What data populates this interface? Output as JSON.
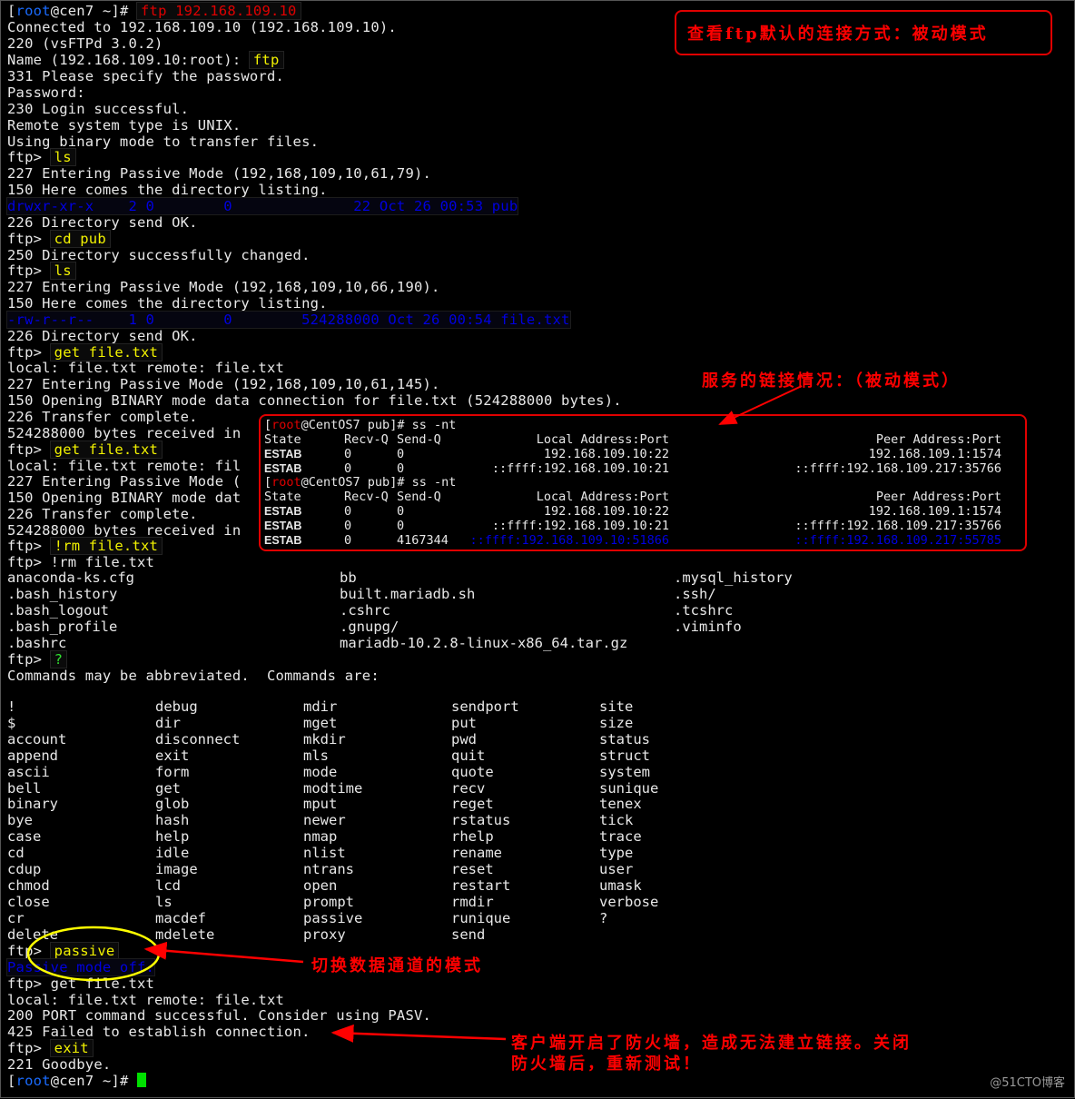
{
  "prompt": {
    "open": "[",
    "user": "root",
    "host_rest": "@cen7 ~]# "
  },
  "lines": {
    "l0_cmd": "ftp 192.168.109.10",
    "l1": "Connected to 192.168.109.10 (192.168.109.10).",
    "l2": "220 (vsFTPd 3.0.2)",
    "l3_pre": "Name (192.168.109.10:root): ",
    "l3_cmd": "ftp",
    "l4": "331 Please specify the password.",
    "l5": "Password:",
    "l6": "230 Login successful.",
    "l7": "Remote system type is UNIX.",
    "l8": "Using binary mode to transfer files.",
    "ftp_prompt": "ftp> ",
    "l9_cmd": "ls",
    "l10": "227 Entering Passive Mode (192,168,109,10,61,79).",
    "l11": "150 Here comes the directory listing.",
    "l12_listing": "drwxr-xr-x    2 0        0              22 Oct 26 00:53 pub",
    "l13": "226 Directory send OK.",
    "l14_cmd": "cd pub",
    "l15": "250 Directory successfully changed.",
    "l16_cmd": "ls",
    "l17": "227 Entering Passive Mode (192,168,109,10,66,190).",
    "l18": "150 Here comes the directory listing.",
    "l19_listing": "-rw-r--r--    1 0        0        524288000 Oct 26 00:54 file.txt",
    "l20": "226 Directory send OK.",
    "l21_cmd": "get file.txt",
    "l22": "local: file.txt remote: file.txt",
    "l23": "227 Entering Passive Mode (192,168,109,10,61,145).",
    "l24": "150 Opening BINARY mode data connection for file.txt (524288000 bytes).",
    "l25": "226 Transfer complete.",
    "l26": "524288000 bytes received in",
    "l27_cmd": "get file.txt",
    "l28": "local: file.txt remote: fil",
    "l29": "227 Entering Passive Mode (",
    "l30": "150 Opening BINARY mode dat",
    "l31": "226 Transfer complete.",
    "l32": "524288000 bytes received in",
    "l33_cmd": "!rm file.txt",
    "l34": "ftp> !rm file.txt",
    "l40_cmd": "?",
    "l41": "Commands may be abbreviated.  Commands are:",
    "l42_cmd": "passive",
    "l43_status": "Passive mode off.",
    "l44": "ftp> get file.txt",
    "l45": "local: file.txt remote: file.txt",
    "l46": "200 PORT command successful. Consider using PASV.",
    "l47": "425 Failed to establish connection.",
    "l48_cmd": "exit",
    "l49": "221 Goodbye."
  },
  "home_listing": [
    [
      "anaconda-ks.cfg",
      "bb",
      ".mysql_history"
    ],
    [
      ".bash_history",
      "built.mariadb.sh",
      ".ssh/"
    ],
    [
      ".bash_logout",
      ".cshrc",
      ".tcshrc"
    ],
    [
      ".bash_profile",
      ".gnupg/",
      ".viminfo"
    ],
    [
      ".bashrc",
      "mariadb-10.2.8-linux-x86_64.tar.gz",
      ""
    ]
  ],
  "commands": [
    [
      "!",
      "$",
      "account",
      "append",
      "ascii",
      "bell",
      "binary",
      "bye",
      "case",
      "cd",
      "cdup",
      "chmod",
      "close",
      "cr",
      "delete"
    ],
    [
      "debug",
      "dir",
      "disconnect",
      "exit",
      "form",
      "get",
      "glob",
      "hash",
      "help",
      "idle",
      "image",
      "lcd",
      "ls",
      "macdef",
      "mdelete"
    ],
    [
      "mdir",
      "mget",
      "mkdir",
      "mls",
      "mode",
      "modtime",
      "mput",
      "newer",
      "nmap",
      "nlist",
      "ntrans",
      "open",
      "prompt",
      "passive",
      "proxy"
    ],
    [
      "sendport",
      "put",
      "pwd",
      "quit",
      "quote",
      "recv",
      "reget",
      "rstatus",
      "rhelp",
      "rename",
      "reset",
      "restart",
      "rmdir",
      "runique",
      "send"
    ],
    [
      "site",
      "size",
      "status",
      "struct",
      "system",
      "sunique",
      "tenex",
      "tick",
      "trace",
      "type",
      "user",
      "umask",
      "verbose",
      "?",
      ""
    ]
  ],
  "ss": {
    "prompt_user": "root",
    "prompt_rest": "@CentOS7 pub]# ss -nt",
    "prompt_open": "[",
    "header": {
      "state": "State",
      "recvq": "Recv-Q",
      "sendq": "Send-Q",
      "local": "Local Address:Port",
      "peer": "Peer Address:Port"
    },
    "first": [
      {
        "state": "ESTAB",
        "recvq": "0",
        "sendq": "0",
        "local": "192.168.109.10:22",
        "peer": "192.168.109.1:1574"
      },
      {
        "state": "ESTAB",
        "recvq": "0",
        "sendq": "0",
        "local": "::ffff:192.168.109.10:21",
        "peer": "::ffff:192.168.109.217:35766"
      }
    ],
    "second": [
      {
        "state": "ESTAB",
        "recvq": "0",
        "sendq": "0",
        "local": "192.168.109.10:22",
        "peer": "192.168.109.1:1574"
      },
      {
        "state": "ESTAB",
        "recvq": "0",
        "sendq": "0",
        "local": "::ffff:192.168.109.10:21",
        "peer": "::ffff:192.168.109.217:35766"
      },
      {
        "state": "ESTAB",
        "recvq": "0",
        "sendq": "4167344",
        "local": "::ffff:192.168.109.10:51866",
        "peer": "::ffff:192.168.109.217:55785"
      }
    ]
  },
  "annotations": {
    "default_mode": "查看ftp默认的连接方式：被动模式",
    "service_conn": "服务的链接情况：（被动模式）",
    "switch_mode": "切换数据通道的模式",
    "firewall_1": "客户端开启了防火墙，造成无法建立链接。关闭",
    "firewall_2": "防火墙后，重新测试！"
  },
  "colors": {
    "annotation": "#ff0000",
    "command": "#f2f200",
    "listing": "#0000e0",
    "cursor": "#00e000",
    "ellipse": "#ffff00"
  },
  "watermark": "@51CTO博客"
}
